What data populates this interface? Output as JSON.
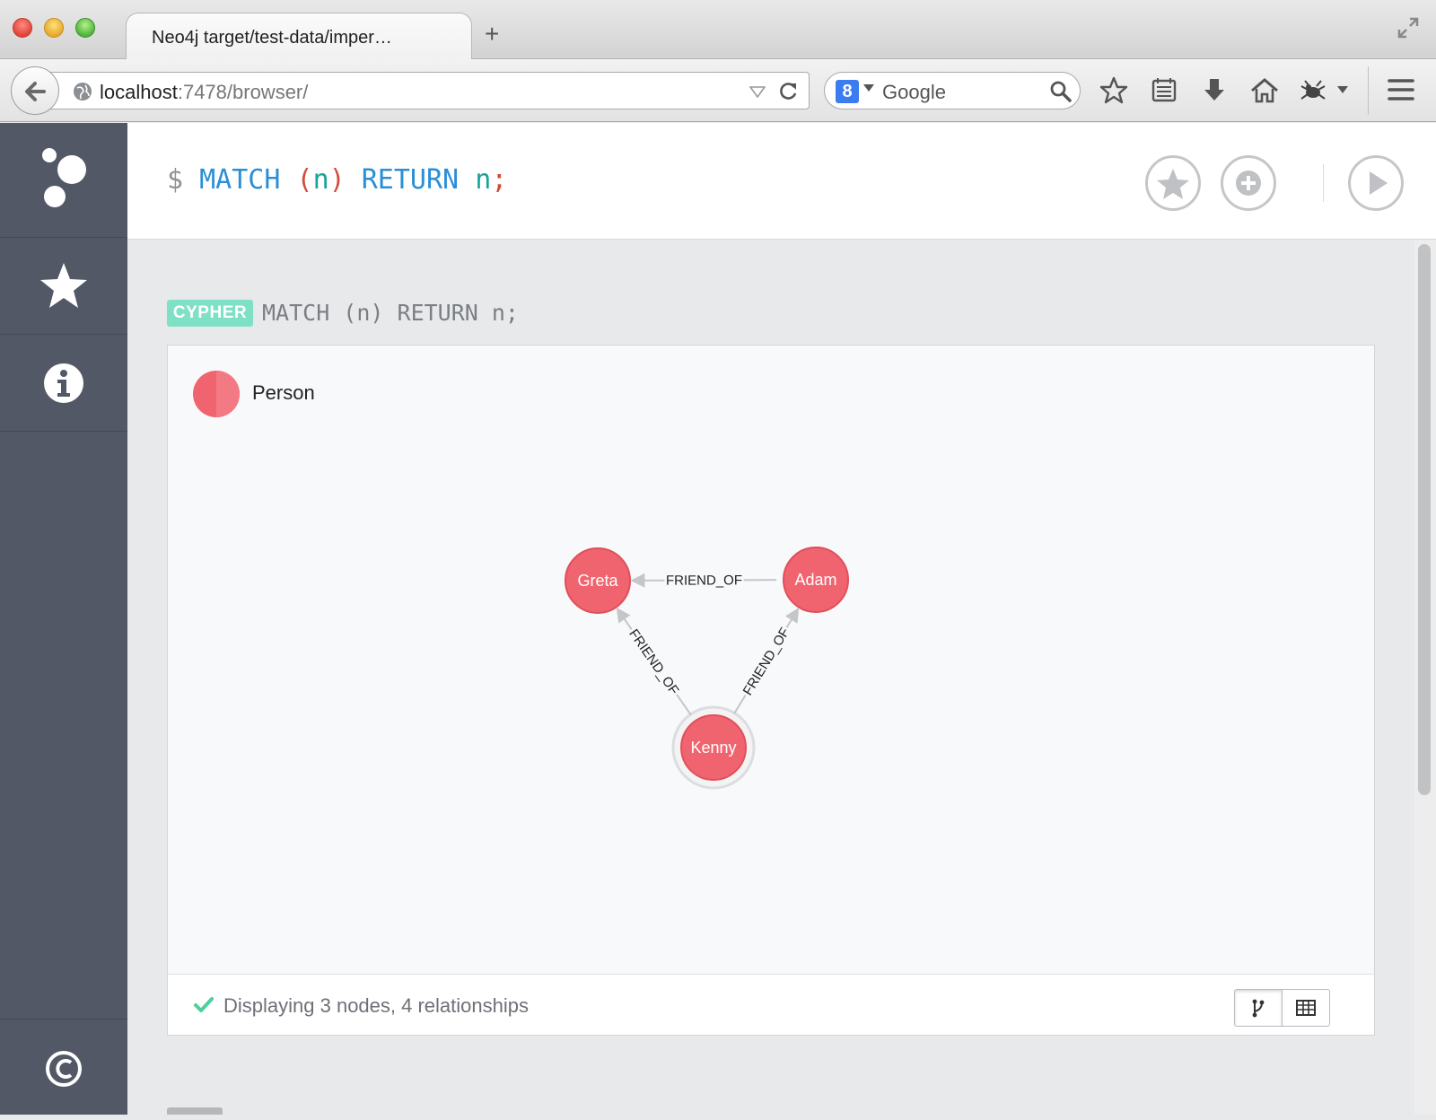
{
  "browser": {
    "tab_title": "Neo4j target/test-data/imper…",
    "new_tab_label": "+",
    "url_host": "localhost",
    "url_rest": ":7478/browser/",
    "search_placeholder": "Google",
    "search_engine_logo": "8"
  },
  "sidebar": {
    "items": [
      {
        "icon": "neo4j-logo-icon"
      },
      {
        "icon": "star-icon"
      },
      {
        "icon": "info-icon"
      },
      {
        "icon": "copyright-icon"
      }
    ]
  },
  "editor": {
    "prompt": "$",
    "kw1": "MATCH",
    "paren_open": "(",
    "var1": "n",
    "paren_close": ")",
    "kw2": "RETURN",
    "var2": "n",
    "semi": ";"
  },
  "frame": {
    "badge": "CYPHER",
    "query": "MATCH (n) RETURN n;",
    "legend_label": "Person",
    "status": "Displaying 3 nodes, 4 relationships"
  },
  "graph": {
    "node_color": "#f0646f",
    "node_border": "#e04f5c",
    "nodes": [
      {
        "id": "greta",
        "label": "Greta"
      },
      {
        "id": "adam",
        "label": "Adam"
      },
      {
        "id": "kenny",
        "label": "Kenny"
      }
    ],
    "relationships": [
      {
        "from": "adam",
        "to": "greta",
        "label": "FRIEND_OF"
      },
      {
        "from": "kenny",
        "to": "greta",
        "label": "FRIEND_OF"
      },
      {
        "from": "kenny",
        "to": "adam",
        "label": "FRIEND_OF"
      }
    ]
  },
  "colors": {
    "sidebar_bg": "#525865",
    "keyword": "#2b8fd6",
    "badge_bg": "#7ee0c5",
    "check": "#4fcf9c"
  }
}
